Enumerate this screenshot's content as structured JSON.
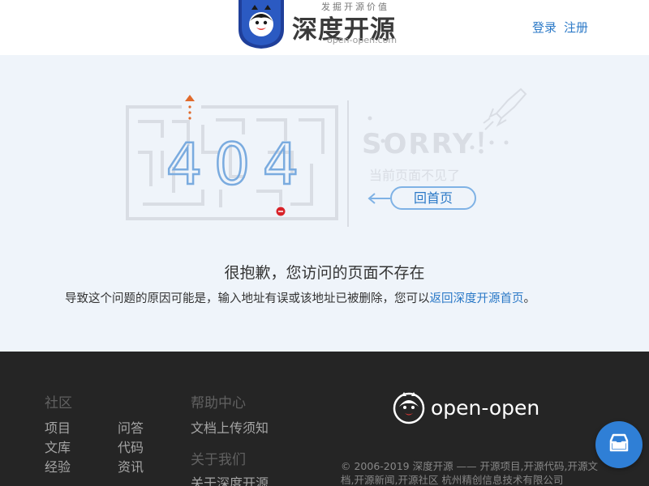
{
  "header": {
    "slogan": "发掘开源价值",
    "brand_cn": "深度开源",
    "brand_en": "open-open.com",
    "login": "登录",
    "register": "注册"
  },
  "error": {
    "code_digits": [
      "4",
      "0",
      "4"
    ],
    "sorry": "SORRY！",
    "not_found": "当前页面不见了",
    "home_button": "回首页",
    "title": "很抱歉，您访问的页面不存在",
    "desc_prefix": "导致这个问题的原因可能是，输入地址有误或该地址已被删除，您可以",
    "desc_link": "返回深度开源首页",
    "desc_suffix": "。"
  },
  "footer": {
    "community": {
      "title": "社区",
      "links": [
        "项目",
        "问答",
        "文库",
        "代码",
        "经验",
        "资讯"
      ]
    },
    "help": {
      "title": "帮助中心",
      "links": [
        "文档上传须知"
      ]
    },
    "about": {
      "title": "关于我们",
      "links": [
        "关于深度开源"
      ]
    },
    "brand": "open-open",
    "copyright": "© 2006-2019 深度开源 —— 开源项目,开源代码,开源文档,开源新闻,开源社区  杭州精创信息技术有限公司"
  },
  "colors": {
    "accent": "#2b79c7",
    "main_bg": "#eff4fa",
    "footer_bg": "#252525",
    "fab": "#2f7fd6",
    "arrow": "#e06a2c",
    "dot": "#d8232a"
  },
  "icons": {
    "fab": "inbox-icon",
    "logo": "penguin-icon",
    "rocket": "rocket-icon"
  }
}
